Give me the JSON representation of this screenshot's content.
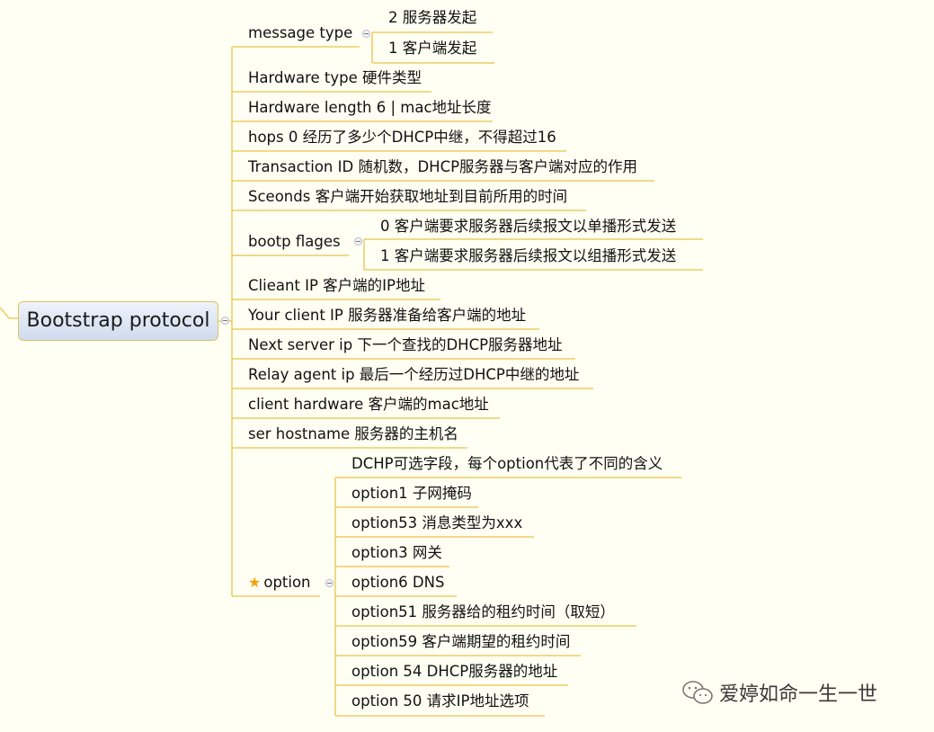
{
  "root": {
    "label": "Bootstrap protocol"
  },
  "nodes": {
    "message_type": "message type",
    "mt_2": "2  服务器发起",
    "mt_1": "1  客户端发起",
    "hardware_type": "Hardware type  硬件类型",
    "hardware_length": "Hardware length 6 | mac地址长度",
    "hops": "hops 0 经历了多少个DHCP中继，不得超过16",
    "transaction_id": "Transaction ID  随机数，DHCP服务器与客户端对应的作用",
    "seconds": "Sceonds 客户端开始获取地址到目前所用的时间",
    "bootp_flags": "bootp flages",
    "bf_0": "0   客户端要求服务器后续报文以单播形式发送",
    "bf_1": "1   客户端要求服务器后续报文以组播形式发送",
    "client_ip": "Clieant IP  客户端的IP地址",
    "your_client_ip": "Your client IP 服务器准备给客户端的地址",
    "next_server_ip": "Next server ip  下一个查找的DHCP服务器地址",
    "relay_agent_ip": "Relay agent ip 最后一个经历过DHCP中继的地址",
    "client_hardware": "client hardware  客户端的mac地址",
    "ser_hostname": "ser hostname  服务器的主机名",
    "option": "option",
    "opt_desc": "DCHP可选字段，每个option代表了不同的含义",
    "opt_1": "option1 子网掩码",
    "opt_53": "option53 消息类型为xxx",
    "opt_3": "option3 网关",
    "opt_6": "option6  DNS",
    "opt_51": "option51  服务器给的租约时间（取短）",
    "opt_59": "option59 客户端期望的租约时间",
    "opt_54": "option 54 DHCP服务器的地址",
    "opt_50": "option 50 请求IP地址选项"
  },
  "watermark": "爱婷如命一生一世",
  "icons": {
    "option_marker": "star-icon",
    "collapse": "collapse-icon",
    "watermark_logo": "wechat-icon"
  },
  "colors": {
    "line": "#e8c44a",
    "background": "#fffff3",
    "root_fill_top": "#eef3fb",
    "root_fill_bottom": "#cfdbee",
    "star": "#f2a20c"
  }
}
